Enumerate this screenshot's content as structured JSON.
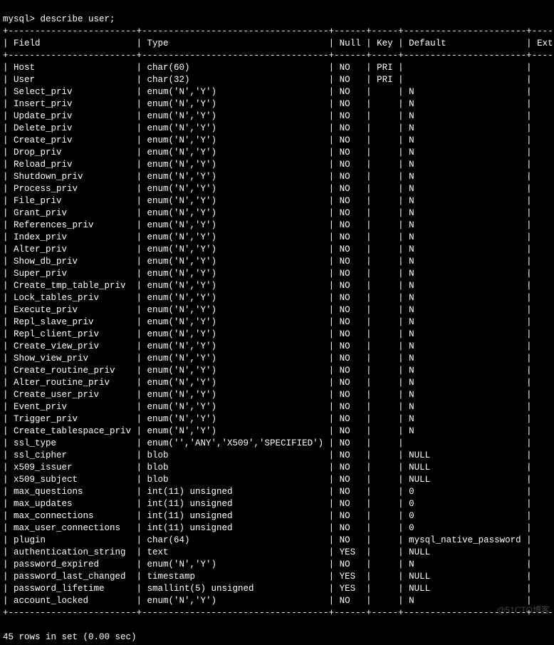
{
  "prompt": "mysql> describe user;",
  "columns": [
    "Field",
    "Type",
    "Null",
    "Key",
    "Default",
    "Extra"
  ],
  "rows": [
    {
      "field": "Host",
      "type": "char(60)",
      "null": "NO",
      "key": "PRI",
      "default": "",
      "extra": ""
    },
    {
      "field": "User",
      "type": "char(32)",
      "null": "NO",
      "key": "PRI",
      "default": "",
      "extra": ""
    },
    {
      "field": "Select_priv",
      "type": "enum('N','Y')",
      "null": "NO",
      "key": "",
      "default": "N",
      "extra": ""
    },
    {
      "field": "Insert_priv",
      "type": "enum('N','Y')",
      "null": "NO",
      "key": "",
      "default": "N",
      "extra": ""
    },
    {
      "field": "Update_priv",
      "type": "enum('N','Y')",
      "null": "NO",
      "key": "",
      "default": "N",
      "extra": ""
    },
    {
      "field": "Delete_priv",
      "type": "enum('N','Y')",
      "null": "NO",
      "key": "",
      "default": "N",
      "extra": ""
    },
    {
      "field": "Create_priv",
      "type": "enum('N','Y')",
      "null": "NO",
      "key": "",
      "default": "N",
      "extra": ""
    },
    {
      "field": "Drop_priv",
      "type": "enum('N','Y')",
      "null": "NO",
      "key": "",
      "default": "N",
      "extra": ""
    },
    {
      "field": "Reload_priv",
      "type": "enum('N','Y')",
      "null": "NO",
      "key": "",
      "default": "N",
      "extra": ""
    },
    {
      "field": "Shutdown_priv",
      "type": "enum('N','Y')",
      "null": "NO",
      "key": "",
      "default": "N",
      "extra": ""
    },
    {
      "field": "Process_priv",
      "type": "enum('N','Y')",
      "null": "NO",
      "key": "",
      "default": "N",
      "extra": ""
    },
    {
      "field": "File_priv",
      "type": "enum('N','Y')",
      "null": "NO",
      "key": "",
      "default": "N",
      "extra": ""
    },
    {
      "field": "Grant_priv",
      "type": "enum('N','Y')",
      "null": "NO",
      "key": "",
      "default": "N",
      "extra": ""
    },
    {
      "field": "References_priv",
      "type": "enum('N','Y')",
      "null": "NO",
      "key": "",
      "default": "N",
      "extra": ""
    },
    {
      "field": "Index_priv",
      "type": "enum('N','Y')",
      "null": "NO",
      "key": "",
      "default": "N",
      "extra": ""
    },
    {
      "field": "Alter_priv",
      "type": "enum('N','Y')",
      "null": "NO",
      "key": "",
      "default": "N",
      "extra": ""
    },
    {
      "field": "Show_db_priv",
      "type": "enum('N','Y')",
      "null": "NO",
      "key": "",
      "default": "N",
      "extra": ""
    },
    {
      "field": "Super_priv",
      "type": "enum('N','Y')",
      "null": "NO",
      "key": "",
      "default": "N",
      "extra": ""
    },
    {
      "field": "Create_tmp_table_priv",
      "type": "enum('N','Y')",
      "null": "NO",
      "key": "",
      "default": "N",
      "extra": ""
    },
    {
      "field": "Lock_tables_priv",
      "type": "enum('N','Y')",
      "null": "NO",
      "key": "",
      "default": "N",
      "extra": ""
    },
    {
      "field": "Execute_priv",
      "type": "enum('N','Y')",
      "null": "NO",
      "key": "",
      "default": "N",
      "extra": ""
    },
    {
      "field": "Repl_slave_priv",
      "type": "enum('N','Y')",
      "null": "NO",
      "key": "",
      "default": "N",
      "extra": ""
    },
    {
      "field": "Repl_client_priv",
      "type": "enum('N','Y')",
      "null": "NO",
      "key": "",
      "default": "N",
      "extra": ""
    },
    {
      "field": "Create_view_priv",
      "type": "enum('N','Y')",
      "null": "NO",
      "key": "",
      "default": "N",
      "extra": ""
    },
    {
      "field": "Show_view_priv",
      "type": "enum('N','Y')",
      "null": "NO",
      "key": "",
      "default": "N",
      "extra": ""
    },
    {
      "field": "Create_routine_priv",
      "type": "enum('N','Y')",
      "null": "NO",
      "key": "",
      "default": "N",
      "extra": ""
    },
    {
      "field": "Alter_routine_priv",
      "type": "enum('N','Y')",
      "null": "NO",
      "key": "",
      "default": "N",
      "extra": ""
    },
    {
      "field": "Create_user_priv",
      "type": "enum('N','Y')",
      "null": "NO",
      "key": "",
      "default": "N",
      "extra": ""
    },
    {
      "field": "Event_priv",
      "type": "enum('N','Y')",
      "null": "NO",
      "key": "",
      "default": "N",
      "extra": ""
    },
    {
      "field": "Trigger_priv",
      "type": "enum('N','Y')",
      "null": "NO",
      "key": "",
      "default": "N",
      "extra": ""
    },
    {
      "field": "Create_tablespace_priv",
      "type": "enum('N','Y')",
      "null": "NO",
      "key": "",
      "default": "N",
      "extra": ""
    },
    {
      "field": "ssl_type",
      "type": "enum('','ANY','X509','SPECIFIED')",
      "null": "NO",
      "key": "",
      "default": "",
      "extra": ""
    },
    {
      "field": "ssl_cipher",
      "type": "blob",
      "null": "NO",
      "key": "",
      "default": "NULL",
      "extra": ""
    },
    {
      "field": "x509_issuer",
      "type": "blob",
      "null": "NO",
      "key": "",
      "default": "NULL",
      "extra": ""
    },
    {
      "field": "x509_subject",
      "type": "blob",
      "null": "NO",
      "key": "",
      "default": "NULL",
      "extra": ""
    },
    {
      "field": "max_questions",
      "type": "int(11) unsigned",
      "null": "NO",
      "key": "",
      "default": "0",
      "extra": ""
    },
    {
      "field": "max_updates",
      "type": "int(11) unsigned",
      "null": "NO",
      "key": "",
      "default": "0",
      "extra": ""
    },
    {
      "field": "max_connections",
      "type": "int(11) unsigned",
      "null": "NO",
      "key": "",
      "default": "0",
      "extra": ""
    },
    {
      "field": "max_user_connections",
      "type": "int(11) unsigned",
      "null": "NO",
      "key": "",
      "default": "0",
      "extra": ""
    },
    {
      "field": "plugin",
      "type": "char(64)",
      "null": "NO",
      "key": "",
      "default": "mysql_native_password",
      "extra": ""
    },
    {
      "field": "authentication_string",
      "type": "text",
      "null": "YES",
      "key": "",
      "default": "NULL",
      "extra": ""
    },
    {
      "field": "password_expired",
      "type": "enum('N','Y')",
      "null": "NO",
      "key": "",
      "default": "N",
      "extra": ""
    },
    {
      "field": "password_last_changed",
      "type": "timestamp",
      "null": "YES",
      "key": "",
      "default": "NULL",
      "extra": ""
    },
    {
      "field": "password_lifetime",
      "type": "smallint(5) unsigned",
      "null": "YES",
      "key": "",
      "default": "NULL",
      "extra": ""
    },
    {
      "field": "account_locked",
      "type": "enum('N','Y')",
      "null": "NO",
      "key": "",
      "default": "N",
      "extra": ""
    }
  ],
  "footer": "45 rows in set (0.00 sec)",
  "watermark": "@51CTO博客",
  "col_widths": {
    "field": 24,
    "type": 35,
    "null": 6,
    "key": 5,
    "default": 23,
    "extra": 7
  }
}
